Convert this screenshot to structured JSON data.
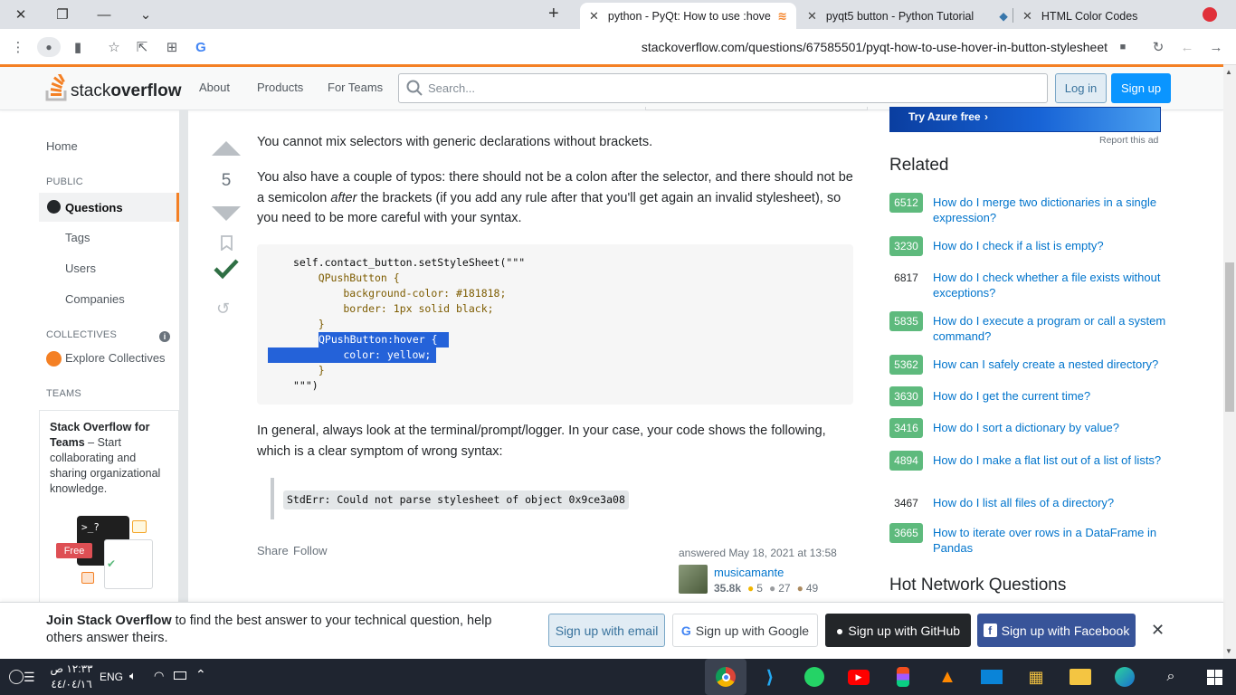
{
  "browser": {
    "tabs": [
      {
        "label": "python - PyQt: How to use :hove",
        "active": true
      },
      {
        "label": "pyqt5 button - Python Tutorial",
        "active": false
      },
      {
        "label": "HTML Color Codes",
        "active": false
      }
    ],
    "url": "stackoverflow.com/questions/67585501/pyqt-how-to-use-hover-in-button-stylesheet"
  },
  "so_header": {
    "logo_light": "stack",
    "logo_bold": "overflow",
    "nav": [
      "About",
      "Products",
      "For Teams"
    ],
    "search_placeholder": "Search...",
    "login": "Log in",
    "signup": "Sign up"
  },
  "left_nav": {
    "home": "Home",
    "public": "PUBLIC",
    "questions": "Questions",
    "tags": "Tags",
    "users": "Users",
    "companies": "Companies",
    "collectives": "COLLECTIVES",
    "explore_collectives": "Explore Collectives",
    "teams": "TEAMS",
    "teams_title": "Stack Overflow for Teams",
    "teams_dash": " – Start collaborating and sharing organizational knowledge.",
    "free_badge": "Free",
    "prompt_glyph": ">_?"
  },
  "answer": {
    "score": "5",
    "p1": "You cannot mix selectors with generic declarations without brackets.",
    "p2_a": "You also have a couple of typos: there should not be a colon after the selector, and there should not be a semicolon ",
    "p2_em": "after",
    "p2_b": " the brackets (if you add any rule after that you'll get again an invalid stylesheet), so you need to be more careful with your syntax.",
    "code_lines": {
      "l1": "self.contact_button.setStyleSheet(\"\"\"",
      "l2": "    QPushButton {",
      "l3": "        background-color: #181818;",
      "l4": "        border: 1px solid black;",
      "l5": "    }",
      "l6": "QPushButton:hover {",
      "l7": "        color: yellow;",
      "l8": "    }",
      "l9": "\"\"\")"
    },
    "p3": "In general, always look at the terminal/prompt/logger. In your case, your code shows the following, which is a clear symptom of wrong syntax:",
    "stderr": "StdErr: Could not parse stylesheet of object 0x9ce3a08",
    "share": "Share",
    "follow": "Follow",
    "answered": "answered May 18, 2021 at 13:58",
    "user": "musicamante",
    "rep": "35.8k",
    "gold": "5",
    "silver": "27",
    "bronze": "49"
  },
  "right": {
    "ad_text": "Try Azure free",
    "report_ad": "Report this ad",
    "related_title": "Related",
    "related": [
      {
        "count": "6512",
        "accepted": true,
        "title": "How do I merge two dictionaries in a single expression?"
      },
      {
        "count": "3230",
        "accepted": true,
        "title": "How do I check if a list is empty?"
      },
      {
        "count": "6817",
        "accepted": false,
        "title": "How do I check whether a file exists without exceptions?"
      },
      {
        "count": "5835",
        "accepted": true,
        "title": "How do I execute a program or call a system command?"
      },
      {
        "count": "5362",
        "accepted": true,
        "title": "How can I safely create a nested directory?"
      },
      {
        "count": "3630",
        "accepted": true,
        "title": "How do I get the current time?"
      },
      {
        "count": "3416",
        "accepted": true,
        "title": "How do I sort a dictionary by value?"
      },
      {
        "count": "4894",
        "accepted": true,
        "title": "How do I make a flat list out of a list of lists?"
      },
      {
        "count": "3467",
        "accepted": false,
        "title": "How do I list all files of a directory?"
      },
      {
        "count": "3665",
        "accepted": true,
        "title": "How to iterate over rows in a DataFrame in Pandas"
      }
    ],
    "hot_title": "Hot Network Questions"
  },
  "banner": {
    "bold": "Join Stack Overflow",
    "text": " to find the best answer to your technical question, help others answer theirs.",
    "email": "Sign up with email",
    "google": "Sign up with Google",
    "github": "Sign up with GitHub",
    "facebook": "Sign up with Facebook"
  },
  "taskbar": {
    "time": "١٢:٣٣ ص",
    "date": "٤٤/٠٤/١٦",
    "lang": "ENG"
  },
  "colors": {
    "so_orange": "#f48024",
    "so_blue": "#0a95ff",
    "link": "#0074cc",
    "accepted_green": "#5eba7d",
    "selection": "#2462d9"
  }
}
